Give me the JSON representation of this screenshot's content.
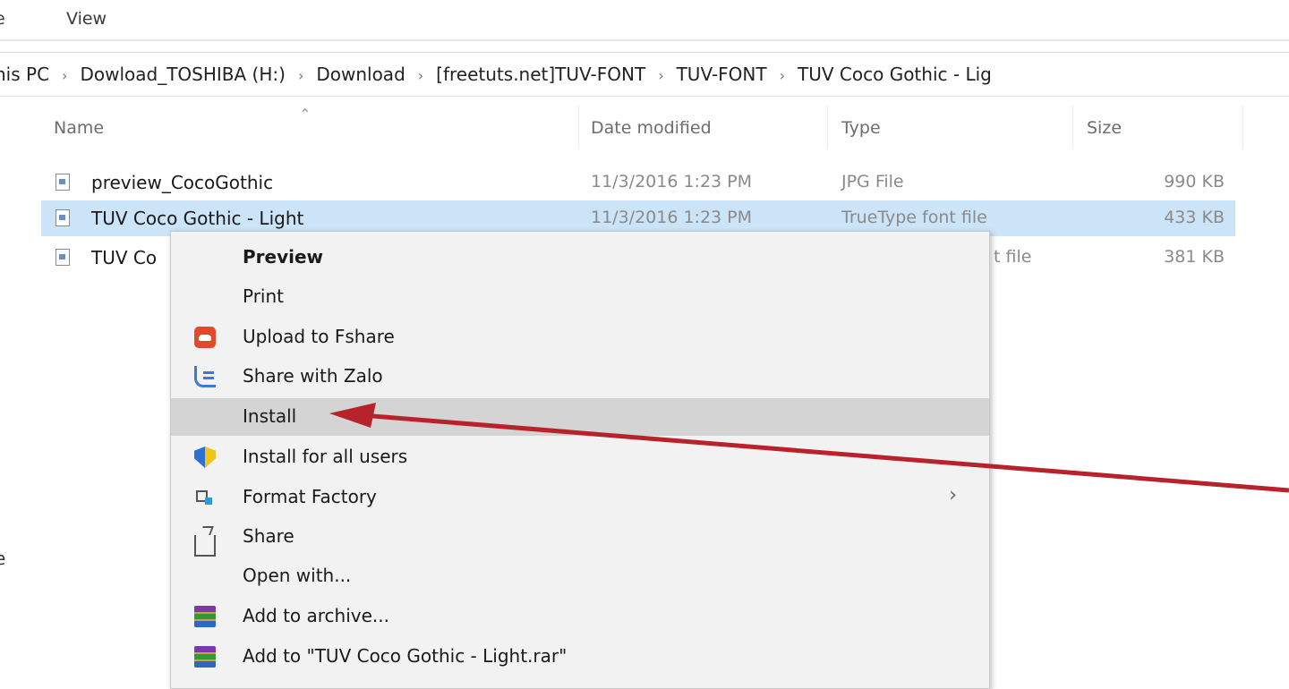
{
  "ribbon": {
    "tabs": [
      "e",
      "View"
    ]
  },
  "address": {
    "crumbs": [
      "his PC",
      "Dowload_TOSHIBA (H:)",
      "Download",
      "[freetuts.net]TUV-FONT",
      "TUV-FONT",
      "TUV Coco Gothic - Lig"
    ]
  },
  "columns": {
    "name": "Name",
    "date": "Date modified",
    "type": "Type",
    "size": "Size"
  },
  "files": [
    {
      "name": "preview_CocoGothic",
      "date": "11/3/2016 1:23 PM",
      "type": "JPG File",
      "size": "990 KB"
    },
    {
      "name": "TUV Coco Gothic - Light",
      "date": "11/3/2016 1:23 PM",
      "type": "TrueType font file",
      "size": "433 KB"
    },
    {
      "name": "TUV Co",
      "date": "",
      "type": "t file",
      "size": "381 KB"
    }
  ],
  "left_edge_glyph": "e",
  "context_menu": {
    "items": [
      {
        "label": "Preview",
        "icon": ""
      },
      {
        "label": "Print",
        "icon": ""
      },
      {
        "label": "Upload to Fshare",
        "icon": "fshare-icon"
      },
      {
        "label": "Share with Zalo",
        "icon": "zalo-icon"
      },
      {
        "label": "Install",
        "icon": ""
      },
      {
        "label": "Install for all users",
        "icon": "shield-icon"
      },
      {
        "label": "Format Factory",
        "icon": "format-factory-icon"
      },
      {
        "label": "Share",
        "icon": "share-icon"
      },
      {
        "label": "Open with...",
        "icon": ""
      },
      {
        "label": "Add to archive...",
        "icon": "winrar-icon"
      },
      {
        "label": "Add to \"TUV Coco Gothic - Light.rar\"",
        "icon": "winrar-icon"
      }
    ],
    "submenu_chevron": "›"
  },
  "colors": {
    "selection": "#cce4f7",
    "menu_bg": "#f2f2f2",
    "menu_hover": "#d4d4d4",
    "annotation_arrow": "#b8222a"
  }
}
